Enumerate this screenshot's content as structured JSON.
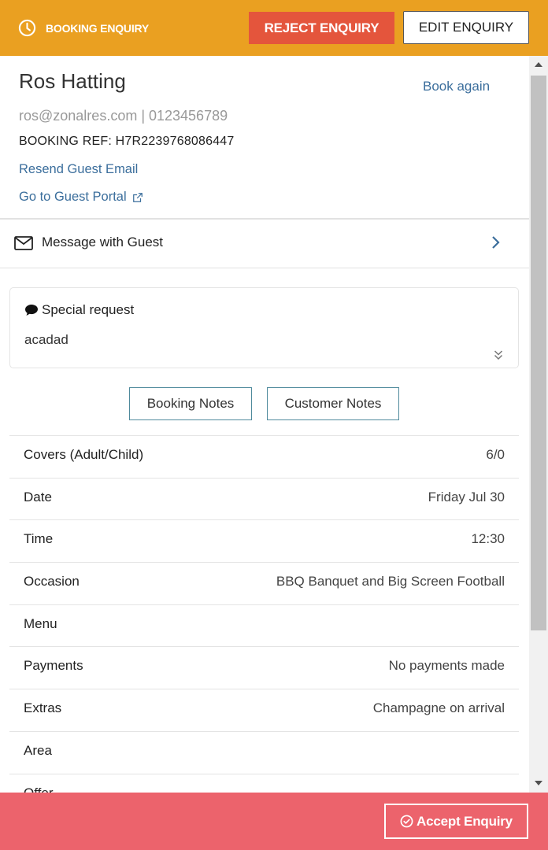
{
  "header": {
    "status_label": "BOOKING ENQUIRY",
    "reject_label": "REJECT ENQUIRY",
    "edit_label": "EDIT ENQUIRY",
    "bg_color": "#eaa021",
    "reject_color": "#e4553c"
  },
  "guest": {
    "name": "Ros Hatting",
    "book_again": "Book again",
    "contact": "ros@zonalres.com | 0123456789",
    "booking_ref": "BOOKING REF: H7R2239768086447",
    "resend_email": "Resend Guest Email",
    "guest_portal": "Go to Guest Portal"
  },
  "message": {
    "label": "Message with Guest"
  },
  "special_request": {
    "title": "Special request",
    "text": "acadad"
  },
  "notes": {
    "booking_notes": "Booking Notes",
    "customer_notes": "Customer Notes"
  },
  "details": [
    {
      "label": "Covers (Adult/Child)",
      "value": "6/0"
    },
    {
      "label": "Date",
      "value": "Friday Jul 30"
    },
    {
      "label": "Time",
      "value": "12:30"
    },
    {
      "label": "Occasion",
      "value": "BBQ Banquet and Big Screen Football"
    },
    {
      "label": "Menu",
      "value": ""
    },
    {
      "label": "Payments",
      "value": "No payments made"
    },
    {
      "label": "Extras",
      "value": "Champagne on arrival"
    },
    {
      "label": "Area",
      "value": ""
    },
    {
      "label": "Offer",
      "value": ""
    }
  ],
  "footer": {
    "accept_label": "Accept Enquiry",
    "bg_color": "#ec636c"
  },
  "icons": [
    "clock-icon",
    "external-link-icon",
    "envelope-icon",
    "chevron-right-icon",
    "speech-bubble-icon",
    "double-chevron-down-icon",
    "check-circle-icon"
  ]
}
